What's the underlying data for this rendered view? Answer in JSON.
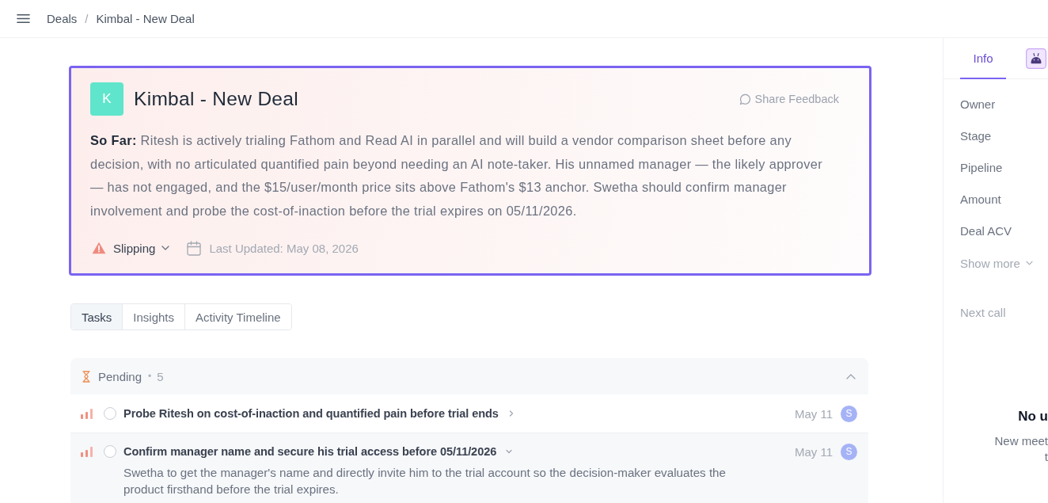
{
  "header": {
    "breadcrumb": {
      "items": [
        "Deals",
        "Kimbal - New Deal"
      ],
      "separator": "/"
    }
  },
  "deal": {
    "initial": "K",
    "title": "Kimbal - New Deal",
    "feedback_label": "Share Feedback",
    "summary": "**So Far:** Ritesh is actively trialing Fathom and Read AI in parallel and will build a vendor comparison sheet before any decision, with no articulated quantified pain beyond needing an AI note-taker. His unnamed manager — the likely approver — has not engaged, and the $15/user/month price sits above Fathom's $13 anchor. Swetha should confirm manager involvement and probe the cost-of-inaction before the trial expires on 05/11/2026.",
    "status": {
      "kind": "warning",
      "label": "Slipping"
    },
    "last_updated": "Last Updated: May 08, 2026"
  },
  "tabs": [
    {
      "label": "Tasks",
      "selected": true
    },
    {
      "label": "Insights",
      "selected": false
    },
    {
      "label": "Activity Timeline",
      "selected": false
    }
  ],
  "task_group": {
    "label": "Pending",
    "separator": "•",
    "count": "5",
    "expanded": true,
    "tasks": [
      {
        "title": "Probe Ritesh on cost-of-inaction and quantified pain before trial ends",
        "checked": false,
        "expanded": false,
        "due": "May 11",
        "assignee": "S"
      },
      {
        "title": "Confirm manager name and secure his trial access before 05/11/2026",
        "checked": false,
        "expanded": true,
        "due": "May 11",
        "assignee": "S",
        "description": "Swetha to get the manager's name and directly invite him to the trial account so the decision-maker evaluates the product firsthand before the trial expires."
      }
    ]
  },
  "side_panel": {
    "tabs": [
      {
        "kind": "text",
        "label": "Info",
        "selected": true
      },
      {
        "kind": "assistant",
        "selected": false
      }
    ],
    "fields": [
      "Owner",
      "Stage",
      "Pipeline",
      "Amount",
      "Deal ACV"
    ],
    "show_more": "Show more",
    "next_call": {
      "label": "Next call",
      "empty_title": "No u",
      "empty_lines": [
        "New meet",
        "t"
      ]
    }
  }
}
